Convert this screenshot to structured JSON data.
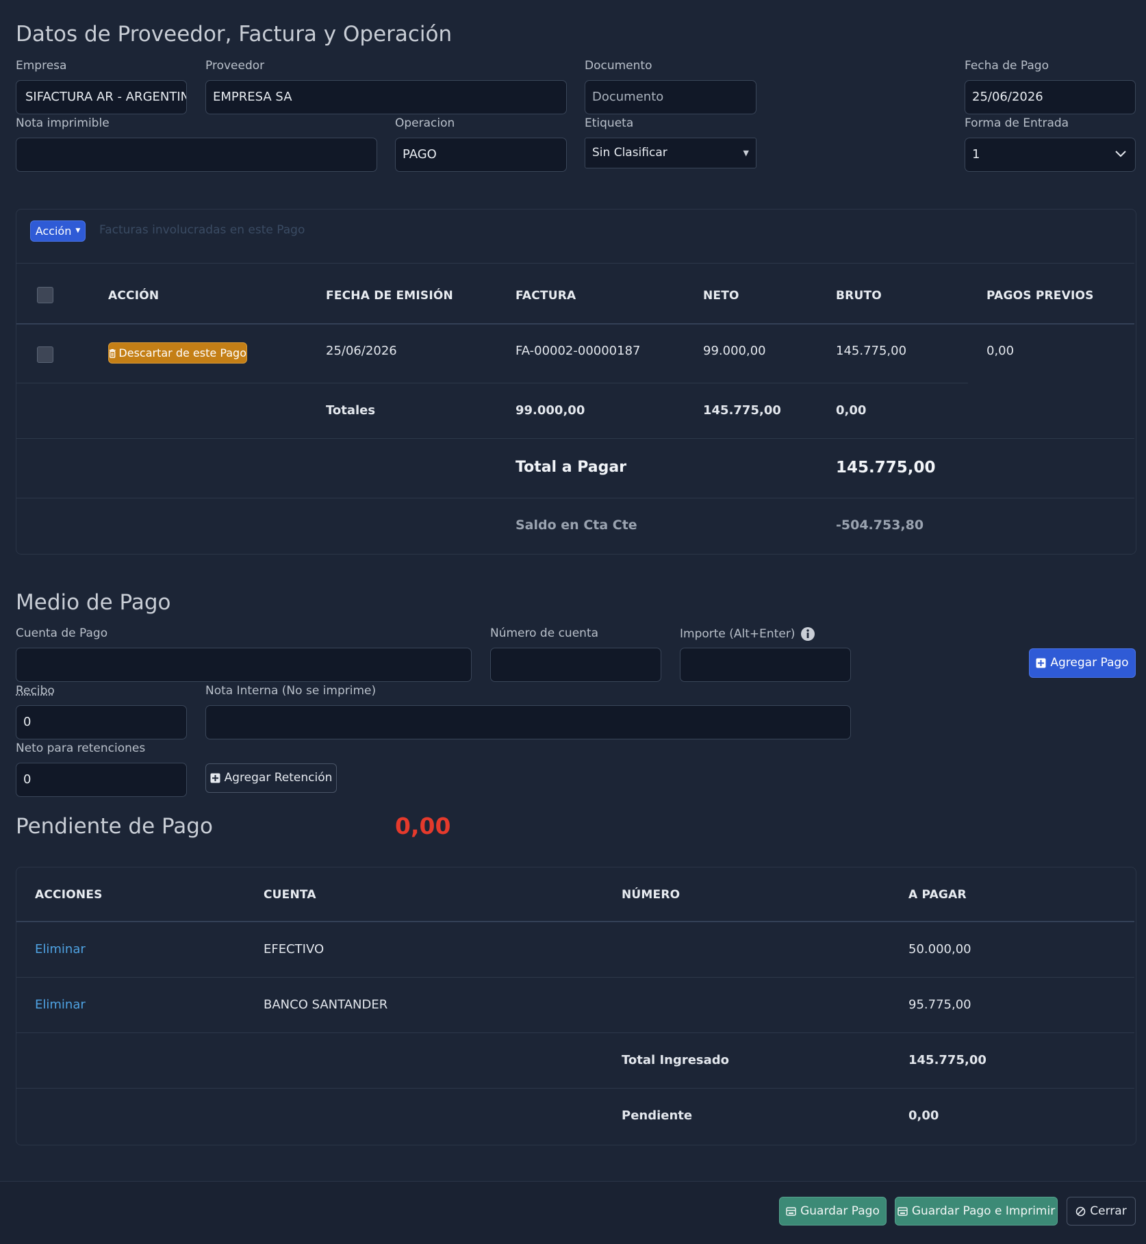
{
  "header": {
    "title": "Datos de Proveedor, Factura y Operación",
    "empresa_label": "Empresa",
    "empresa_value": "SIFACTURA AR - ARGENTINA",
    "proveedor_label": "Proveedor",
    "proveedor_value": "EMPRESA SA",
    "documento_label": "Documento",
    "documento_placeholder": "Documento",
    "fecha_pago_label": "Fecha de Pago",
    "fecha_pago_value": "25/06/2026",
    "nota_label": "Nota imprimible",
    "nota_value": "",
    "operacion_label": "Operacion",
    "operacion_value": "PAGO",
    "etiqueta_label": "Etiqueta",
    "etiqueta_value": "Sin Clasificar",
    "forma_entrada_label": "Forma de Entrada",
    "forma_entrada_value": "1"
  },
  "facturas": {
    "accion_button": "Acción",
    "subtitle": "Facturas involucradas en este Pago",
    "columns": [
      "ACCIÓN",
      "FECHA DE EMISIÓN",
      "FACTURA",
      "NETO",
      "BRUTO",
      "PAGOS PREVIOS"
    ],
    "rows": [
      {
        "action": "Descartar de este Pago",
        "fecha": "25/06/2026",
        "factura": "FA-00002-00000187",
        "neto": "99.000,00",
        "bruto": "145.775,00",
        "previos": "0,00"
      }
    ],
    "totales_label": "Totales",
    "totales_neto": "99.000,00",
    "totales_bruto": "145.775,00",
    "totales_previos": "0,00",
    "total_pagar_label": "Total a Pagar",
    "total_pagar_value": "145.775,00",
    "saldo_label": "Saldo en Cta Cte",
    "saldo_value": "-504.753,80"
  },
  "medio": {
    "title": "Medio de Pago",
    "cuenta_label": "Cuenta de Pago",
    "numero_label": "Número de cuenta",
    "importe_label": "Importe (Alt+Enter)",
    "agregar_pago": "Agregar Pago",
    "recibo_label": "Recibo",
    "recibo_value": "0",
    "nota_interna_label": "Nota Interna (No se imprime)",
    "neto_ret_label": "Neto para retenciones",
    "neto_ret_value": "0",
    "agregar_retencion": "Agregar Retención"
  },
  "pendiente": {
    "title": "Pendiente de Pago",
    "value": "0,00"
  },
  "pagos": {
    "columns": [
      "ACCIONES",
      "CUENTA",
      "NÚMERO",
      "A PAGAR"
    ],
    "rows": [
      {
        "action": "Eliminar",
        "cuenta": "EFECTIVO",
        "numero": "",
        "apagar": "50.000,00"
      },
      {
        "action": "Eliminar",
        "cuenta": "BANCO SANTANDER",
        "numero": "",
        "apagar": "95.775,00"
      }
    ],
    "total_label": "Total Ingresado",
    "total_value": "145.775,00",
    "pendiente_label": "Pendiente",
    "pendiente_value": "0,00"
  },
  "footer": {
    "guardar": "Guardar Pago",
    "guardar_imprimir": "Guardar Pago e Imprimir",
    "cerrar": "Cerrar"
  },
  "colors": {
    "background": "#1c2536",
    "primary": "#2f5bd6",
    "success": "#3c8a76",
    "warning": "#c47f16",
    "danger": "#e53a2c",
    "link": "#4fa3e3"
  }
}
